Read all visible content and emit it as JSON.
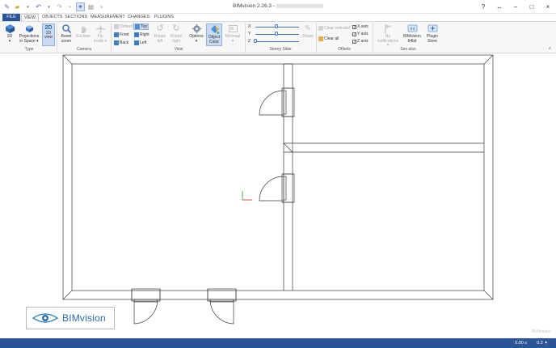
{
  "window": {
    "title": "BIMvision 2.26.3 -",
    "controls": [
      "?",
      "↔",
      "–",
      "□",
      "×"
    ]
  },
  "tabs": {
    "file": "FILE",
    "view": "VIEW",
    "objects": "OBJECTS",
    "sections": "SECTIONS",
    "measurement": "MEASUREMENT",
    "changes": "CHANGES",
    "plugins": "PLUGINS"
  },
  "ribbon": {
    "type_group": {
      "label": "Type",
      "btn_3d": "3D",
      "btn_proj": "Projections in Space",
      "btn_2d": "2D view"
    },
    "camera_group": {
      "label": "Camera",
      "reset_zoom": "Reset zoom",
      "enclose": "Enclose",
      "fly_mode": "Fly mode"
    },
    "view_group": {
      "label": "View",
      "default": "Default",
      "top": "Top",
      "front": "Front",
      "right": "Right",
      "back": "Back",
      "left": "Left",
      "rotate_left": "Rotate left",
      "rotate_right": "Rotate right",
      "options": "Options",
      "object_color": "Object Color",
      "minimap": "Minimap"
    },
    "storey_group": {
      "label": "Storey Slide",
      "x": "X",
      "y": "Y",
      "z": "Z",
      "reset": "Reset"
    },
    "offsets_group": {
      "label": "Offsets",
      "clear_selected": "Clear selected",
      "clear_all": "Clear all",
      "x_axis": "X axis",
      "y_axis": "Y axis",
      "z_axis": "Z axis",
      "check": "✓"
    },
    "seealso_group": {
      "label": "See also",
      "no_notifications": "No notifications",
      "bimvision64": "BIMvision 64bit",
      "plugin_store": "Plugin Store"
    }
  },
  "canvas": {
    "logo": "BIMvision",
    "watermark": "BIMvision"
  },
  "status": {
    "scale": "0.00 s",
    "zoom": "0.2 ✦"
  }
}
